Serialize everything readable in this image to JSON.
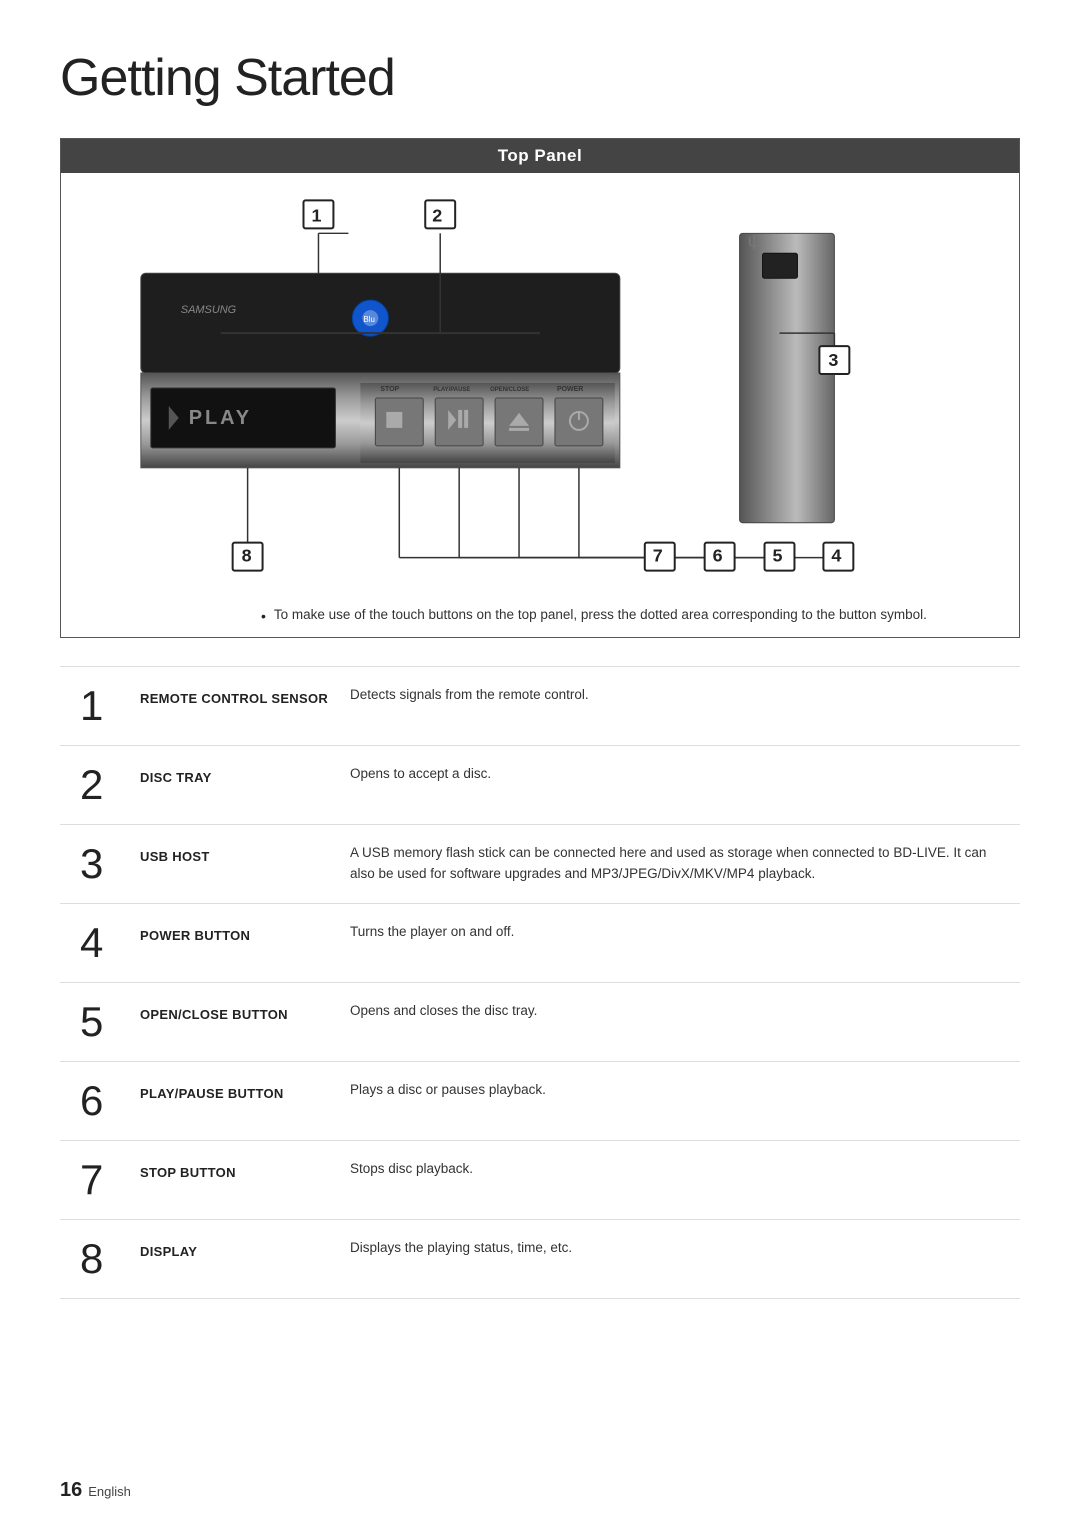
{
  "page": {
    "title": "Getting Started",
    "footer_number": "16",
    "footer_language": "English"
  },
  "top_panel": {
    "header": "Top Panel",
    "note": "To make use of the touch buttons on the top panel, press the dotted area corresponding to the button symbol."
  },
  "features": [
    {
      "number": "1",
      "label": "REMOTE CONTROL SENSOR",
      "description": "Detects signals from the remote control."
    },
    {
      "number": "2",
      "label": "DISC TRAY",
      "description": "Opens to accept a disc."
    },
    {
      "number": "3",
      "label": "USB HOST",
      "description": "A USB memory flash stick can be connected here and used as storage when connected to BD-LIVE. It can also be used for software upgrades and MP3/JPEG/DivX/MKV/MP4 playback."
    },
    {
      "number": "4",
      "label": "POWER BUTTON",
      "description": "Turns the player on and off."
    },
    {
      "number": "5",
      "label": "OPEN/CLOSE BUTTON",
      "description": "Opens and closes the disc tray."
    },
    {
      "number": "6",
      "label": "PLAY/PAUSE BUTTON",
      "description": "Plays a disc or pauses playback."
    },
    {
      "number": "7",
      "label": "STOP BUTTON",
      "description": "Stops disc playback."
    },
    {
      "number": "8",
      "label": "DISPLAY",
      "description": "Displays the playing status, time, etc."
    }
  ]
}
